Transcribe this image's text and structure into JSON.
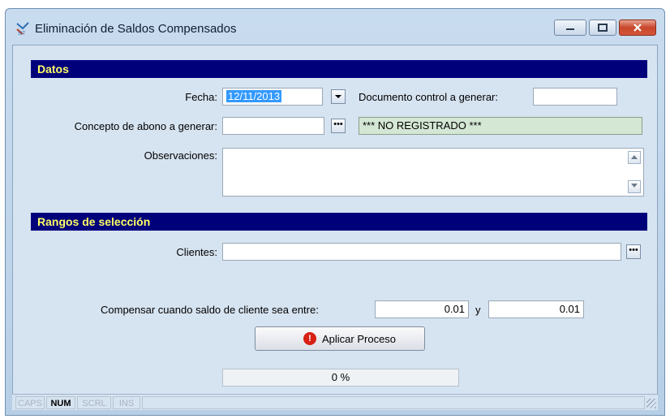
{
  "window": {
    "title": "Eliminación de Saldos Compensados",
    "controls": {
      "minimize": "▁",
      "maximize": "▢",
      "close": "✕"
    }
  },
  "datos": {
    "header": "Datos",
    "fecha": {
      "label": "Fecha:",
      "value": "12/11/2013"
    },
    "documento": {
      "label": "Documento control a generar:",
      "value": ""
    },
    "concepto": {
      "label": "Concepto de abono a generar:",
      "value": "",
      "status": "*** NO REGISTRADO ***"
    },
    "observaciones": {
      "label": "Observaciones:",
      "value": ""
    }
  },
  "rangos": {
    "header": "Rangos de selección",
    "clientes": {
      "label": "Clientes:",
      "value": ""
    },
    "compensar": {
      "label": "Compensar cuando saldo de cliente sea entre:",
      "min": "0.01",
      "and": "y",
      "max": "0.01"
    }
  },
  "action": {
    "label": "Aplicar Proceso",
    "icon": "stop-icon"
  },
  "progress": {
    "text": "0 %",
    "percent": 0
  },
  "statusbar": {
    "indicators": [
      {
        "label": "CAPS",
        "active": false
      },
      {
        "label": "NUM",
        "active": true
      },
      {
        "label": "SCRL",
        "active": false
      },
      {
        "label": "INS",
        "active": false
      }
    ]
  },
  "colors": {
    "section_header_bg": "#00007b",
    "section_header_text": "#ffff66",
    "selection": "#3399ff",
    "readonly_field": "#d4e6d4"
  }
}
